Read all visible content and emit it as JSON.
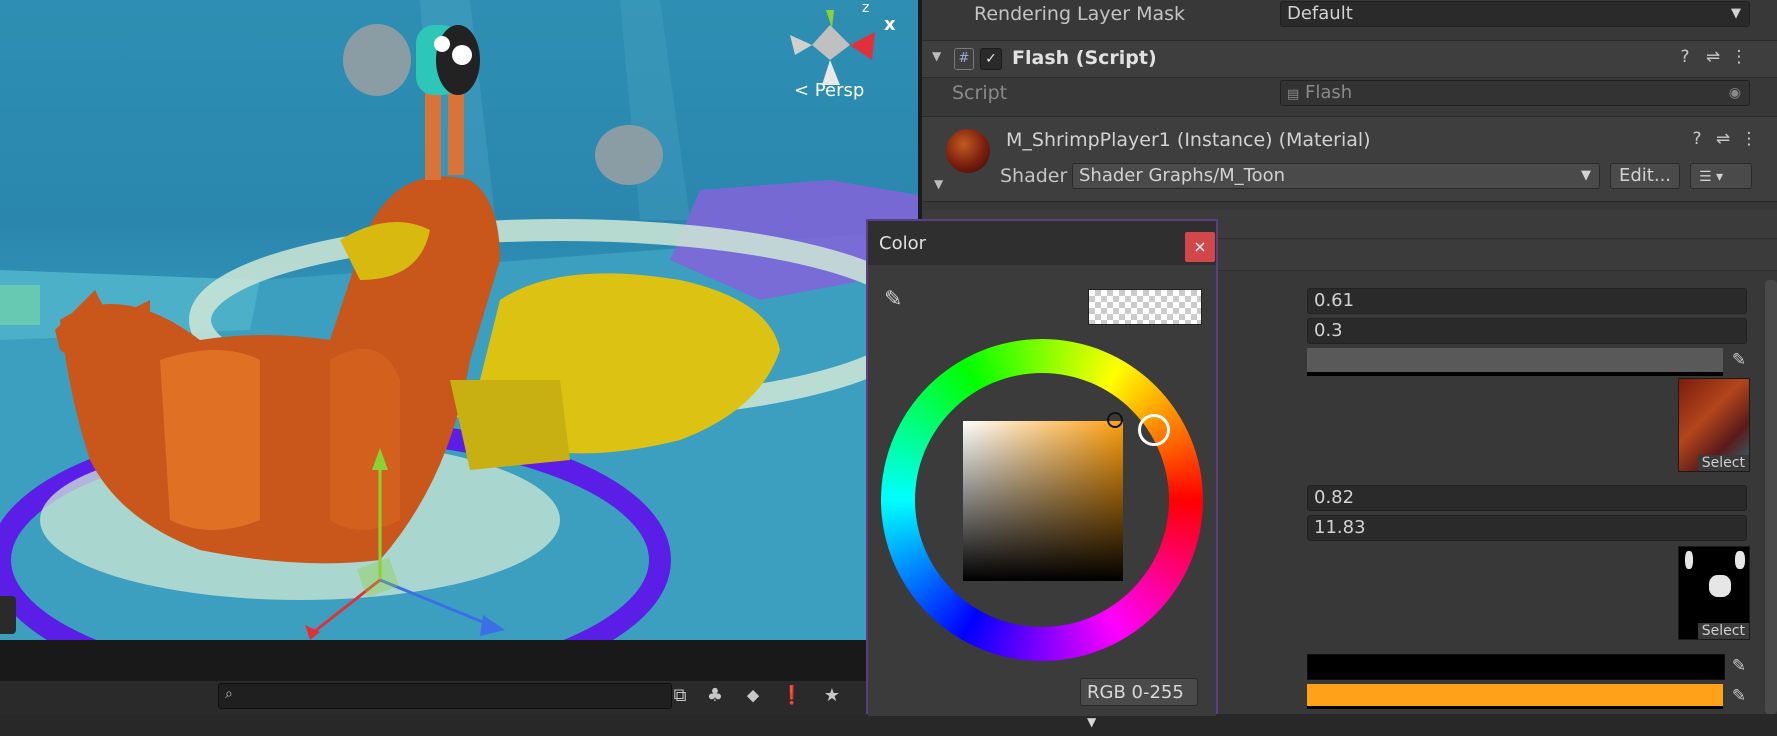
{
  "scene": {
    "persp_label": "< Persp",
    "gizmo_axis_x": "x",
    "gizmo_axis_z": "z"
  },
  "toolbar": {
    "search_placeholder": ""
  },
  "inspector": {
    "rendering_layer_mask": {
      "label": "Rendering Layer Mask",
      "value": "Default"
    },
    "flash_component": {
      "title": "Flash (Script)",
      "script_label": "Script",
      "script_value": "Flash"
    },
    "material": {
      "name": "M_ShrimpPlayer1 (Instance) (Material)",
      "shader_label": "Shader",
      "shader_value": "Shader Graphs/M_Toon",
      "edit_label": "Edit..."
    },
    "fields": {
      "float1": "0.61",
      "float2": "0.3",
      "float3": "0.82",
      "float4": "11.83",
      "select1": "Select",
      "select2": "Select"
    },
    "colors": {
      "swatch_gray": "#595959",
      "swatch_black": "#000000",
      "swatch_orange": "#ffa21a"
    }
  },
  "color_picker": {
    "title": "Color",
    "close_label": "×",
    "mode_label": "RGB 0-255",
    "hue_color": "#ff9f0e"
  }
}
